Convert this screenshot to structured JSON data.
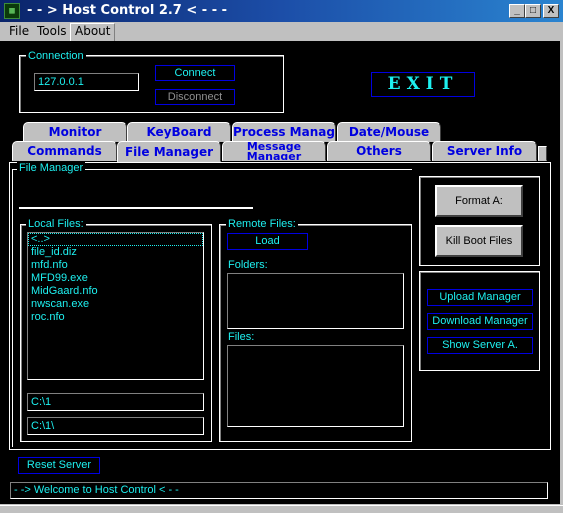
{
  "window": {
    "title": "- - > Host Control 2.7 < - - -",
    "icon": "app-icon",
    "controls": {
      "minimize": "_",
      "maximize": "□",
      "close": "X"
    }
  },
  "menu": [
    {
      "label": "File",
      "underline": "F"
    },
    {
      "label": "Tools",
      "underline": "T"
    },
    {
      "label": "About",
      "underline": "A"
    }
  ],
  "connection": {
    "legend": "Connection",
    "host_value": "127.0.0.1",
    "connect_label": "Connect",
    "disconnect_label": "Disconnect"
  },
  "exit_label": "EXIT",
  "tabs": {
    "row_back": [
      "Monitor",
      "KeyBoard",
      "Process Manager",
      "Date/Mouse"
    ],
    "row_front": [
      "Commands",
      "File Manager",
      "Message Manager",
      "Others",
      "Server Info"
    ],
    "active": "File Manager"
  },
  "file_manager": {
    "legend": "File Manager",
    "local": {
      "legend": "Local Files:",
      "items": [
        "<..>",
        "file_id.diz",
        "mfd.nfo",
        "MFD99.exe",
        "MidGaard.nfo",
        "nwscan.exe",
        "roc.nfo"
      ],
      "selected": "<..>",
      "path1": "C:\\1",
      "path2": "C:\\1\\"
    },
    "remote": {
      "legend": "Remote Files:",
      "load_label": "Load",
      "folders_label": "Folders:",
      "files_label": "Files:"
    },
    "danger": {
      "format_label": "Format A:",
      "kill_boot_label": "Kill Boot Files"
    },
    "managers": {
      "upload_label": "Upload Manager",
      "download_label": "Download Manager",
      "show_server_label": "Show Server A."
    }
  },
  "reset_server_label": "Reset Server",
  "status_text": "- -> Welcome to Host Control < - -",
  "colors": {
    "accent_text": "#1ef0f0",
    "button_border": "#0000e0",
    "background": "#000000",
    "tab_text": "#0000e0"
  }
}
